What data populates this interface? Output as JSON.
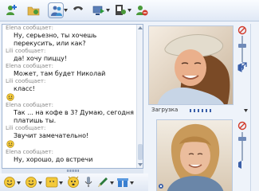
{
  "toolbar": {
    "buttons": [
      {
        "icon": "add-contact-icon"
      },
      {
        "icon": "send-file-icon"
      },
      {
        "icon": "video-call-icon",
        "active": true
      },
      {
        "icon": "phone-icon"
      },
      {
        "icon": "share-screen-icon"
      },
      {
        "icon": "games-icon"
      },
      {
        "icon": "block-icon"
      }
    ]
  },
  "chat": {
    "messages": [
      {
        "sender": "Elena сообщает:",
        "lines": [
          "Ну, серьезно, ты хочешь",
          "перекусить, или как?"
        ]
      },
      {
        "sender": "Lili сообщает:",
        "lines": [
          "да! хочу пиццу!"
        ]
      },
      {
        "sender": "Elena сообщает:",
        "lines": [
          "Может, там будет Николай"
        ]
      },
      {
        "sender": "Lili сообщает:",
        "lines": [
          "класс!"
        ]
      },
      {
        "sender": "",
        "smiley": true
      },
      {
        "sender": "Elena сообщает:",
        "lines": [
          "Так ... на кофе в 3? Думаю, сегодня",
          "платишь ты."
        ]
      },
      {
        "sender": "Lili сообщает:",
        "lines": [
          "Звучит замечательно!"
        ]
      },
      {
        "sender": "",
        "smiley": true
      },
      {
        "sender": "Elena сообщает:",
        "lines": [
          "Ну, хорошо, до встречи"
        ]
      }
    ]
  },
  "video": {
    "status_label": "Загрузка"
  },
  "colors": {
    "accent": "#3a5fa8",
    "sender_gray": "#8a8a8a",
    "panel_border": "#9fb4d2"
  }
}
